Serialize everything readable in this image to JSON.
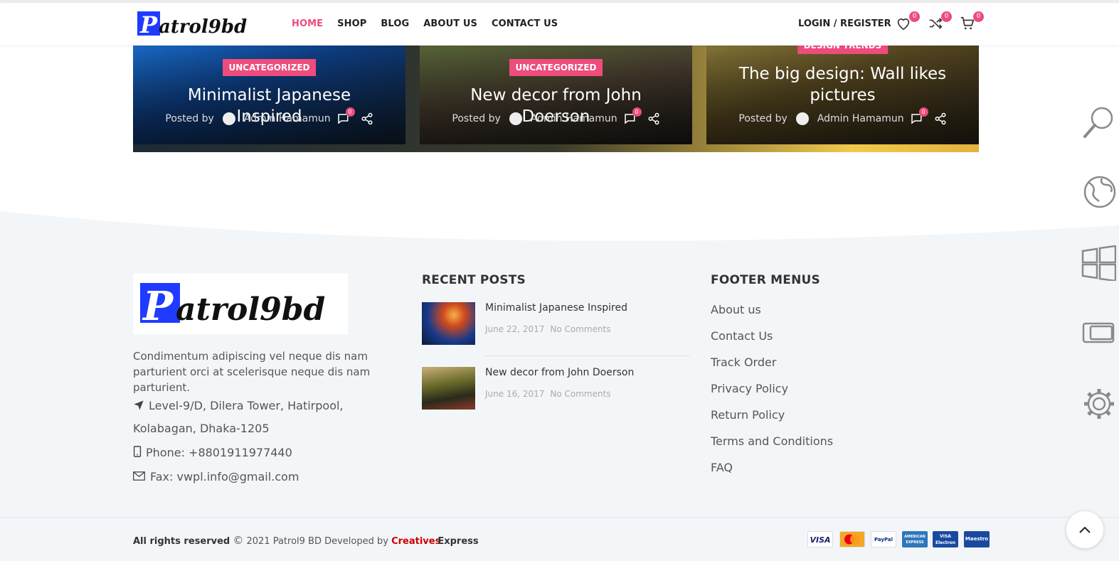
{
  "brand": {
    "logo_text": "Patrol9bd"
  },
  "nav": {
    "items": [
      "HOME",
      "SHOP",
      "BLOG",
      "ABOUT US",
      "CONTACT US"
    ],
    "active": "HOME"
  },
  "header": {
    "login_register": "LOGIN / REGISTER",
    "wishlist_count": "0",
    "compare_count": "0",
    "cart_count": "0"
  },
  "posts": [
    {
      "category": "UNCATEGORIZED",
      "title": "Minimalist Japanese Inspired",
      "posted_by": "Posted by",
      "author": "Admin Hamamun",
      "comments": "0"
    },
    {
      "category": "UNCATEGORIZED",
      "title": "New decor from John Doerson",
      "posted_by": "Posted by",
      "author": "Admin Hamamun",
      "comments": "0"
    },
    {
      "category": "DESIGN TRENDS",
      "title": "The big design: Wall likes pictures",
      "posted_by": "Posted by",
      "author": "Admin Hamamun",
      "comments": "0"
    }
  ],
  "footer": {
    "description": "Condimentum adipiscing vel neque dis nam parturient orci at scelerisque neque dis nam parturient.",
    "address": "Level-9/D, Dilera Tower, Hatirpool, Kolabagan, Dhaka-1205",
    "phone": "Phone: +8801911977440",
    "fax": "Fax: vwpl.info@gmail.com",
    "recent_posts_title": "RECENT POSTS",
    "recent_posts": [
      {
        "title": "Minimalist Japanese Inspired",
        "date": "June 22, 2017",
        "comments": "No Comments"
      },
      {
        "title": "New decor from John Doerson",
        "date": "June 16, 2017",
        "comments": "No Comments"
      }
    ],
    "menus_title": "FOOTER MENUS",
    "menus": [
      "About us",
      "Contact Us",
      "Track Order",
      "Privacy Policy",
      "Return Policy",
      "Terms and Conditions",
      "FAQ"
    ]
  },
  "bottom": {
    "rights": "All rights reserved",
    "copyright_rest": "2021 Patrol9 BD Developed by",
    "dev_part1": "Creatives",
    "dev_part2": "Express",
    "payments": [
      "VISA",
      "MasterCard",
      "PayPal",
      "AMERICAN EXPRESS",
      "VISA Electron",
      "Maestro"
    ]
  },
  "colors": {
    "accent": "#ee4c7c",
    "footer_bg": "#f3f6f9",
    "logo_blue": "#1f3bff"
  }
}
